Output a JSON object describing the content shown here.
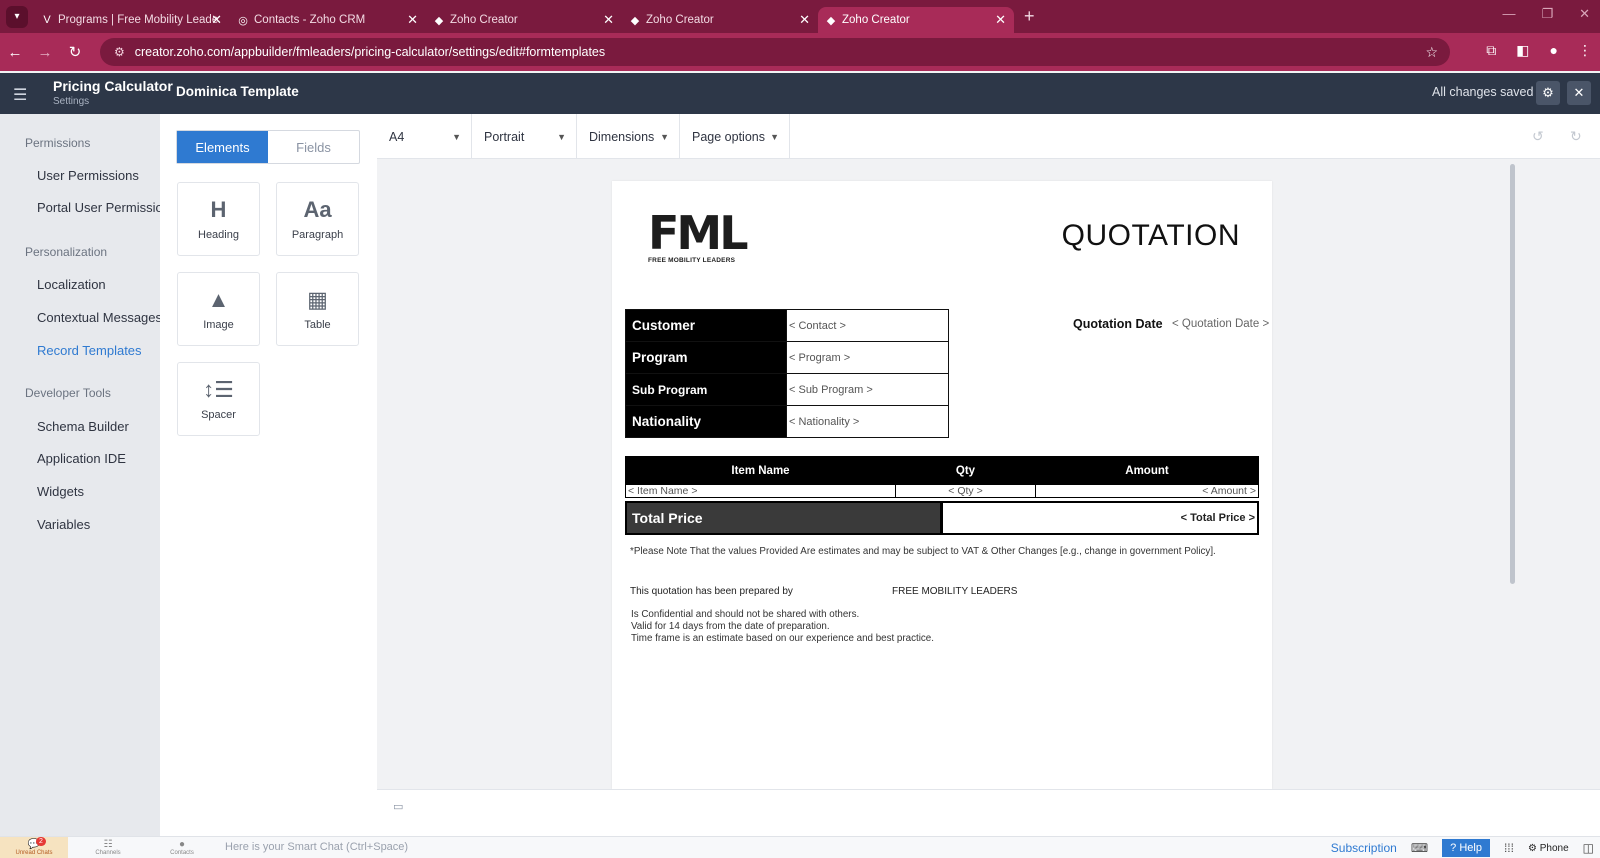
{
  "browser": {
    "tabs": [
      {
        "title": "Programs | Free Mobility Leade",
        "icon": "V"
      },
      {
        "title": "Contacts - Zoho CRM",
        "icon": "◎"
      },
      {
        "title": "Zoho Creator",
        "icon": "◆"
      },
      {
        "title": "Zoho Creator",
        "icon": "◆"
      },
      {
        "title": "Zoho Creator",
        "icon": "◆"
      }
    ],
    "url": "creator.zoho.com/appbuilder/fmleaders/pricing-calculator/settings/edit#formtemplates"
  },
  "header": {
    "app_title": "Pricing Calculator",
    "app_subtitle": "Settings",
    "doc_title": "Dominica Template",
    "save_status": "All changes saved"
  },
  "sidebar": {
    "groups": [
      {
        "label": "Permissions",
        "items": [
          "User Permissions",
          "Portal User Permissions"
        ]
      },
      {
        "label": "Personalization",
        "items": [
          "Localization",
          "Contextual Messages",
          "Record Templates"
        ]
      },
      {
        "label": "Developer Tools",
        "items": [
          "Schema Builder",
          "Application IDE",
          "Widgets",
          "Variables"
        ]
      }
    ],
    "active_item": "Record Templates"
  },
  "panel": {
    "tabs": [
      "Elements",
      "Fields"
    ],
    "active_tab": "Elements",
    "elements": [
      {
        "label": "Heading",
        "icon": "H"
      },
      {
        "label": "Paragraph",
        "icon": "Aa"
      },
      {
        "label": "Image",
        "icon": "▲"
      },
      {
        "label": "Table",
        "icon": "▦"
      },
      {
        "label": "Spacer",
        "icon": "↕☰"
      }
    ]
  },
  "toolbar": {
    "page_size": "A4",
    "orientation": "Portrait",
    "dimensions": "Dimensions",
    "page_options": "Page options"
  },
  "template": {
    "logo_text": "FML",
    "logo_tagline": "FREE MOBILITY LEADERS",
    "title": "QUOTATION",
    "fields": [
      {
        "label": "Customer",
        "value": "< Contact >"
      },
      {
        "label": "Program",
        "value": "< Program >"
      },
      {
        "label": "Sub Program",
        "value": "< Sub Program >"
      },
      {
        "label": "Nationality",
        "value": "< Nationality >"
      }
    ],
    "quotation_date_label": "Quotation Date",
    "quotation_date_value": "< Quotation Date >",
    "items_table": {
      "headers": [
        "Item Name",
        "Qty",
        "Amount"
      ],
      "row": [
        "< Item Name >",
        "< Qty >",
        "< Amount >"
      ]
    },
    "total_label": "Total Price",
    "total_value": "< Total Price >",
    "note": "*Please Note That the values Provided Are estimates and may be subject to VAT & Other Changes [e.g., change in government Policy].",
    "prepared_by": "This quotation has been prepared by",
    "prepared_org": "FREE MOBILITY LEADERS",
    "conditions": [
      "Is Confidential and should not be shared with others.",
      "Valid for 14 days from the date of preparation.",
      "Time frame is an estimate based on our experience and best practice."
    ]
  },
  "bottombar": {
    "tabs": [
      "Unread Chats",
      "Channels",
      "Contacts"
    ],
    "unread_count": "2",
    "smart_chat_placeholder": "Here is your Smart Chat (Ctrl+Space)",
    "subscription": "Subscription",
    "help": "Help",
    "phone": "Phone"
  },
  "colors": {
    "browser_chrome": "#a82b58",
    "header_bg": "#2d3748",
    "accent": "#2f7ad1"
  }
}
